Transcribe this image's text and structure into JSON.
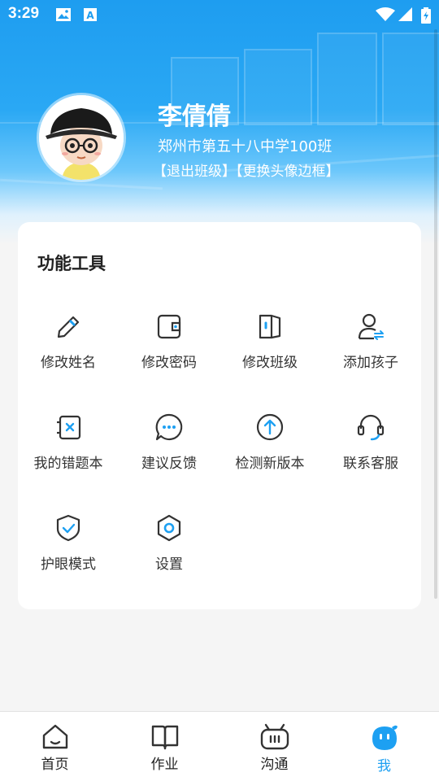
{
  "status_bar": {
    "time": "3:29"
  },
  "profile": {
    "name": "李倩倩",
    "school": "郑州市第五十八中学100班",
    "exit_class": "【退出班级】",
    "change_frame": "【更换头像边框】"
  },
  "tools_section": {
    "title": "功能工具",
    "items": [
      {
        "label": "修改姓名",
        "icon": "pencil-icon"
      },
      {
        "label": "修改密码",
        "icon": "wallet-lock-icon"
      },
      {
        "label": "修改班级",
        "icon": "door-icon"
      },
      {
        "label": "添加孩子",
        "icon": "add-user-icon"
      },
      {
        "label": "我的错题本",
        "icon": "error-book-icon"
      },
      {
        "label": "建议反馈",
        "icon": "chat-bubble-icon"
      },
      {
        "label": "检测新版本",
        "icon": "upload-arrow-icon"
      },
      {
        "label": "联系客服",
        "icon": "headset-icon"
      },
      {
        "label": "护眼模式",
        "icon": "shield-check-icon"
      },
      {
        "label": "设置",
        "icon": "hexagon-settings-icon"
      }
    ]
  },
  "bottom_nav": {
    "items": [
      {
        "label": "首页",
        "icon": "home-icon"
      },
      {
        "label": "作业",
        "icon": "book-icon"
      },
      {
        "label": "沟通",
        "icon": "chat-tv-icon"
      },
      {
        "label": "我",
        "icon": "me-mascot-icon",
        "active": true
      }
    ]
  },
  "colors": {
    "accent": "#1da0f2",
    "header_top": "#1e9df0",
    "icon_stroke": "#333333"
  }
}
